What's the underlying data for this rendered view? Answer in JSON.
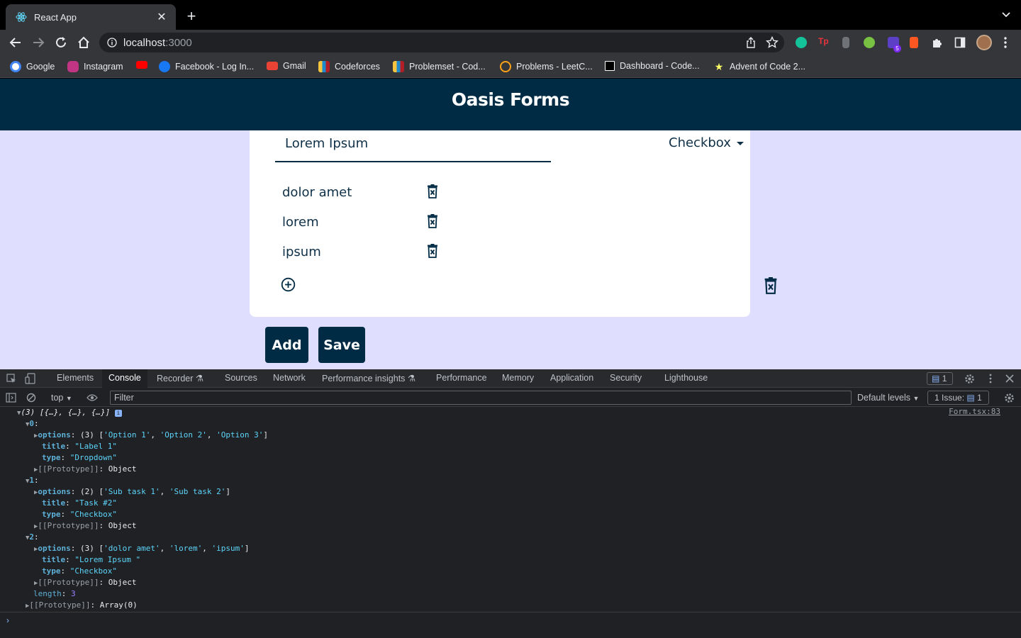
{
  "browser": {
    "tab_title": "React App",
    "url_host": "localhost",
    "url_port": ":3000",
    "extension_badge": "5",
    "bookmarks": [
      {
        "label": "Google",
        "icon": "google-icon",
        "color": "#4285f4"
      },
      {
        "label": "Instagram",
        "icon": "instagram-icon",
        "color": "#c13584"
      },
      {
        "label": "",
        "icon": "youtube-icon",
        "color": "#ff0000"
      },
      {
        "label": "Facebook - Log In...",
        "icon": "facebook-icon",
        "color": "#1877f2"
      },
      {
        "label": "Gmail",
        "icon": "gmail-icon",
        "color": "#ea4335"
      },
      {
        "label": "Codeforces",
        "icon": "codeforces-icon",
        "color": "#1f8acb"
      },
      {
        "label": "Problemset - Cod...",
        "icon": "codeforces-icon",
        "color": "#1f8acb"
      },
      {
        "label": "Problems - LeetC...",
        "icon": "leetcode-icon",
        "color": "#ffa116"
      },
      {
        "label": "Dashboard - Code...",
        "icon": "codechef-icon",
        "color": "#ffffff"
      },
      {
        "label": "Advent of Code 2...",
        "icon": "aoc-star-icon",
        "color": "#ffff66"
      }
    ]
  },
  "app": {
    "brand": "Oasis Forms",
    "question_title": "Lorem Ipsum",
    "question_type": "Checkbox",
    "options": [
      "dolor amet",
      "lorem",
      "ipsum"
    ],
    "add_label": "Add",
    "save_label": "Save",
    "accent_color": "#002b45",
    "page_bg": "#e0deff"
  },
  "devtools": {
    "tabs": [
      "Elements",
      "Console",
      "Recorder",
      "Sources",
      "Network",
      "Performance insights",
      "Performance",
      "Memory",
      "Application",
      "Security",
      "Lighthouse"
    ],
    "active_tab": "Console",
    "issues_badge": "1",
    "context": "top",
    "filter_placeholder": "Filter",
    "levels": "Default levels",
    "issue_count": "1 Issue:",
    "issue_count_value": "1",
    "source_link": "Form.tsx:83",
    "log": {
      "header": "(3) [{…}, {…}, {…}]",
      "items": [
        {
          "index": "0",
          "options_summary": "(3)",
          "options": [
            "'Option 1'",
            "'Option 2'",
            "'Option 3'"
          ],
          "title": "\"Label 1\"",
          "type": "\"Dropdown\""
        },
        {
          "index": "1",
          "options_summary": "(2)",
          "options": [
            "'Sub task 1'",
            "'Sub task 2'"
          ],
          "title": "\"Task #2\"",
          "type": "\"Checkbox\""
        },
        {
          "index": "2",
          "options_summary": "(3)",
          "options": [
            "'dolor amet'",
            "'lorem'",
            "'ipsum'"
          ],
          "title": "\"Lorem Ipsum \"",
          "type": "\"Checkbox\""
        }
      ],
      "prototype_object": "Object",
      "length_key": "length",
      "length_value": "3",
      "array_prototype": "Array(0)"
    }
  }
}
